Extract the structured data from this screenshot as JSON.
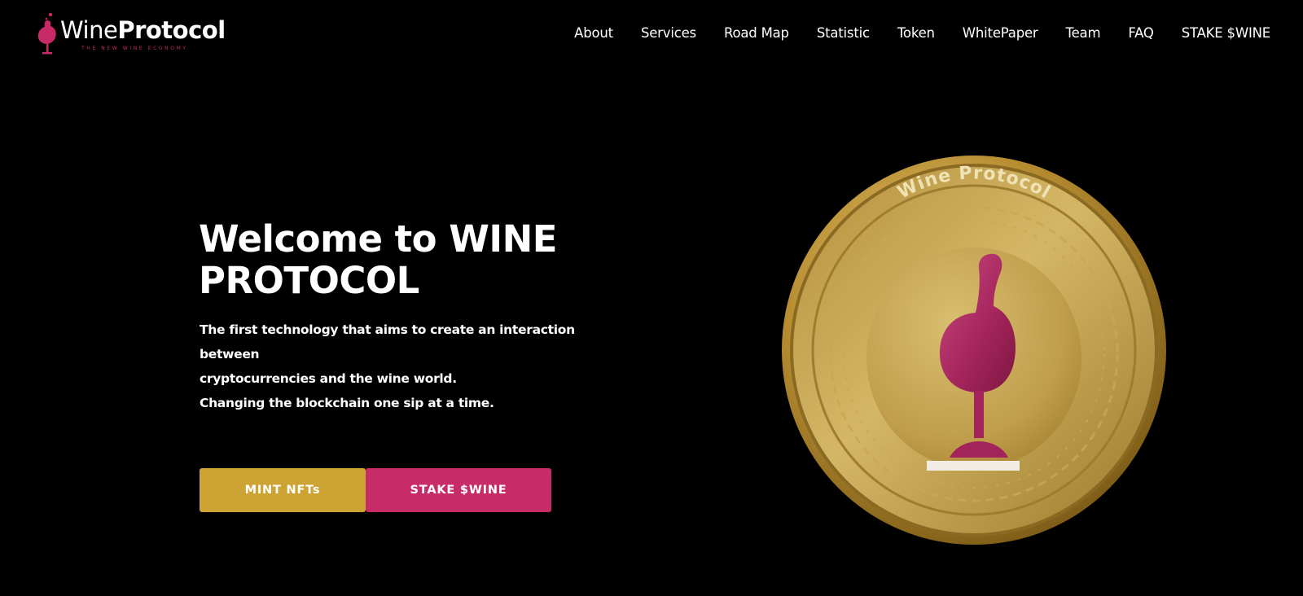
{
  "brand": {
    "name_light": "Wine",
    "name_bold": "Protocol",
    "tagline": "THE NEW WINE ECONOMY",
    "accent_color": "#c72a66"
  },
  "nav": {
    "items": [
      "About",
      "Services",
      "Road Map",
      "Statistic",
      "Token",
      "WhitePaper",
      "Team",
      "FAQ",
      "STAKE $WINE"
    ]
  },
  "hero": {
    "title": "Welcome to WINE PROTOCOL",
    "description": [
      "The first technology that aims to create an interaction between",
      "cryptocurrencies and the wine world.",
      "Changing the blockchain one sip at a time."
    ],
    "buttons": {
      "mint_label": "MINT NFTs",
      "stake_label": "STAKE $WINE"
    },
    "button_colors": {
      "mint": "#cda434",
      "stake": "#c82c68"
    }
  },
  "coin": {
    "label": "Wine Protocol",
    "icon": "wine-glass-icon",
    "color": "#c9a64a"
  }
}
